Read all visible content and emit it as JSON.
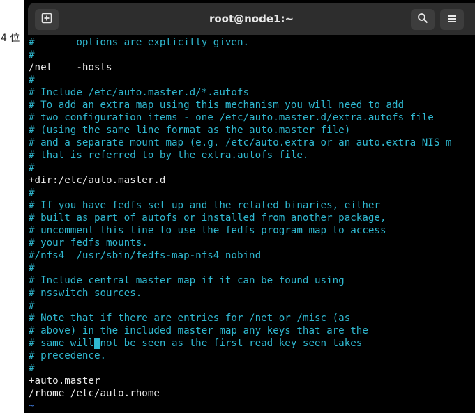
{
  "side_label": "4 位",
  "window": {
    "title": "root@node1:~",
    "buttons": {
      "new_tab_icon": "new-tab-icon",
      "search_icon": "search-icon",
      "menu_icon": "hamburger-menu-icon"
    }
  },
  "editor": {
    "lines": [
      {
        "type": "comment",
        "text": "#       options are explicitly given."
      },
      {
        "type": "comment",
        "text": "#"
      },
      {
        "type": "plain",
        "text": "/net    -hosts"
      },
      {
        "type": "comment",
        "text": "#"
      },
      {
        "type": "comment",
        "text": "# Include /etc/auto.master.d/*.autofs"
      },
      {
        "type": "comment",
        "text": "# To add an extra map using this mechanism you will need to add"
      },
      {
        "type": "comment",
        "text": "# two configuration items - one /etc/auto.master.d/extra.autofs file"
      },
      {
        "type": "comment",
        "text": "# (using the same line format as the auto.master file)"
      },
      {
        "type": "comment",
        "text": "# and a separate mount map (e.g. /etc/auto.extra or an auto.extra NIS m"
      },
      {
        "type": "comment",
        "text": "# that is referred to by the extra.autofs file."
      },
      {
        "type": "comment",
        "text": "#"
      },
      {
        "type": "plain",
        "text": "+dir:/etc/auto.master.d"
      },
      {
        "type": "comment",
        "text": "#"
      },
      {
        "type": "comment",
        "text": "# If you have fedfs set up and the related binaries, either"
      },
      {
        "type": "comment",
        "text": "# built as part of autofs or installed from another package,"
      },
      {
        "type": "comment",
        "text": "# uncomment this line to use the fedfs program map to access"
      },
      {
        "type": "comment",
        "text": "# your fedfs mounts."
      },
      {
        "type": "comment",
        "text": "#/nfs4  /usr/sbin/fedfs-map-nfs4 nobind"
      },
      {
        "type": "comment",
        "text": "#"
      },
      {
        "type": "comment",
        "text": "# Include central master map if it can be found using"
      },
      {
        "type": "comment",
        "text": "# nsswitch sources."
      },
      {
        "type": "comment",
        "text": "#"
      },
      {
        "type": "comment",
        "text": "# Note that if there are entries for /net or /misc (as"
      },
      {
        "type": "comment",
        "text": "# above) in the included master map any keys that are the"
      },
      {
        "type": "comment",
        "text": "# same will not be seen as the first read key seen takes",
        "cursor_col": 11
      },
      {
        "type": "comment",
        "text": "# precedence."
      },
      {
        "type": "comment",
        "text": "#"
      },
      {
        "type": "plain",
        "text": "+auto.master"
      },
      {
        "type": "plain",
        "text": "/rhome /etc/auto.rhome"
      },
      {
        "type": "tilde",
        "text": "~"
      }
    ]
  },
  "colors": {
    "comment": "#2fb8d0",
    "plain": "#e8e8e8",
    "tilde": "#3a6fc8",
    "titlebar": "#2d2d2d",
    "background": "#000000"
  }
}
